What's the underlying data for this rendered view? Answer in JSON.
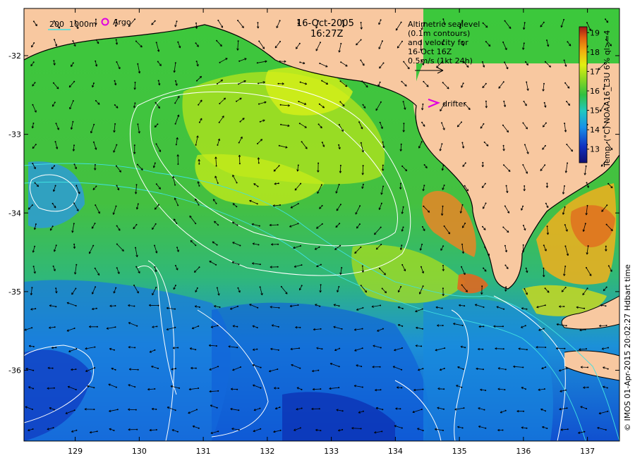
{
  "header": {
    "date": "16-Oct-2005",
    "time": "16:27Z"
  },
  "legend": {
    "isobath_labels": "200  1000m",
    "argo_label": "Argo",
    "drifter_label": "drifter",
    "altimetry_lines": [
      "Altimetric sealevel",
      "(0.1m contours)",
      "and velocity for",
      "16-Oct 16Z",
      "0.5m/s (1kt 24h)"
    ]
  },
  "colorbar": {
    "title": "Temp. (°C) NOAA16_L3U 6% ql>=4",
    "ticks": [
      "13",
      "14",
      "15",
      "16",
      "17",
      "18",
      "19"
    ],
    "range": [
      12.3,
      19.3
    ]
  },
  "credit": "© IMOS 01-Apr-2015 20:02:27 Hdbart time",
  "axes": {
    "x_ticks": [
      "129",
      "130",
      "131",
      "132",
      "133",
      "134",
      "135",
      "136",
      "137"
    ],
    "y_ticks": [
      "-32",
      "-33",
      "-34",
      "-35",
      "-36"
    ],
    "lon_range": [
      128.2,
      137.5
    ],
    "lat_range": [
      -36.9,
      -31.4
    ]
  },
  "colors": {
    "land": "#f8c8a0",
    "warm_sst": "#e07020",
    "cool_sst": "#1060e0",
    "contour": "#ffffff",
    "isobath": "#40e0e0",
    "argo": "#e000e0"
  }
}
